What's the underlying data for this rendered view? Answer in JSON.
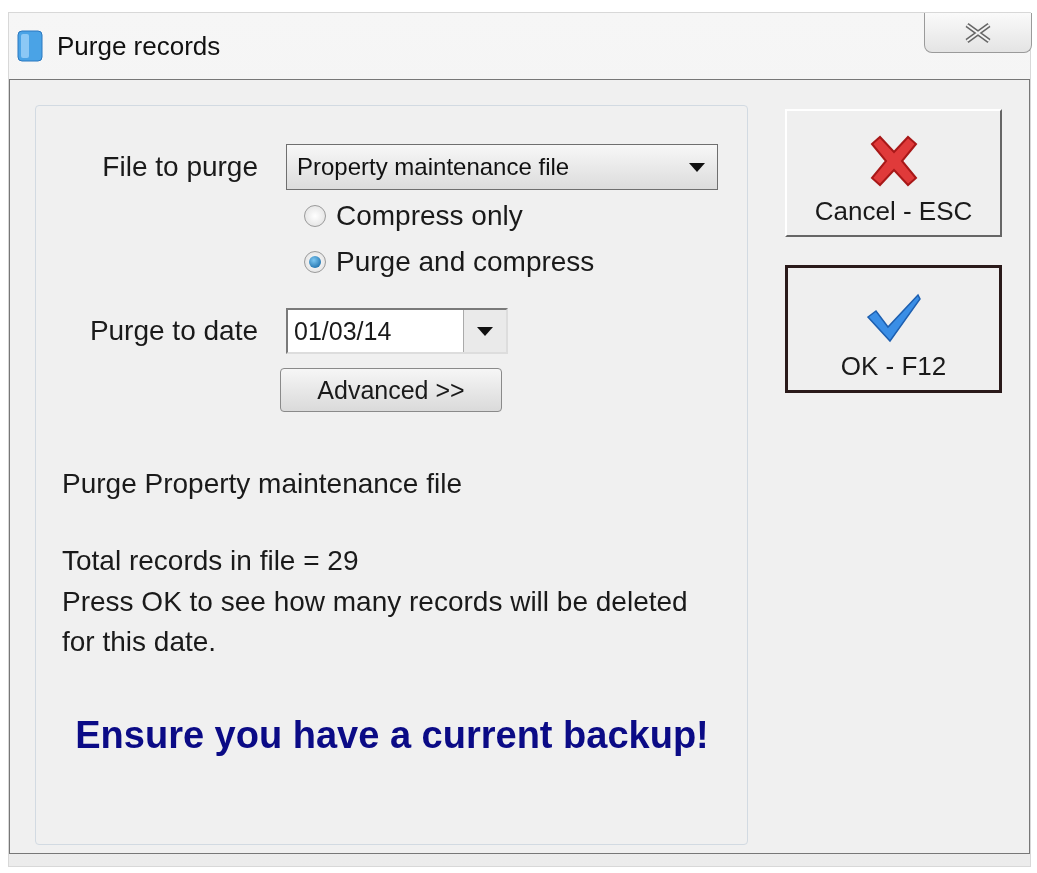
{
  "window": {
    "title": "Purge records"
  },
  "file_to_purge": {
    "label": "File to purge",
    "value": "Property maintenance file"
  },
  "mode_options": [
    {
      "label": "Compress only",
      "selected": false
    },
    {
      "label": "Purge and compress",
      "selected": true
    }
  ],
  "purge_to_date": {
    "label": "Purge to date",
    "value": "01/03/14"
  },
  "advanced_button": "Advanced >>",
  "info_title": "Purge Property maintenance file",
  "info_lines": [
    "Total records in file = 29",
    "Press OK to see how many records will be deleted for this date."
  ],
  "warning": "Ensure you have a current backup!",
  "buttons": [
    {
      "kind": "cancel",
      "label": "Cancel - ESC",
      "default": false
    },
    {
      "kind": "ok",
      "label": "OK - F12",
      "default": true
    }
  ]
}
